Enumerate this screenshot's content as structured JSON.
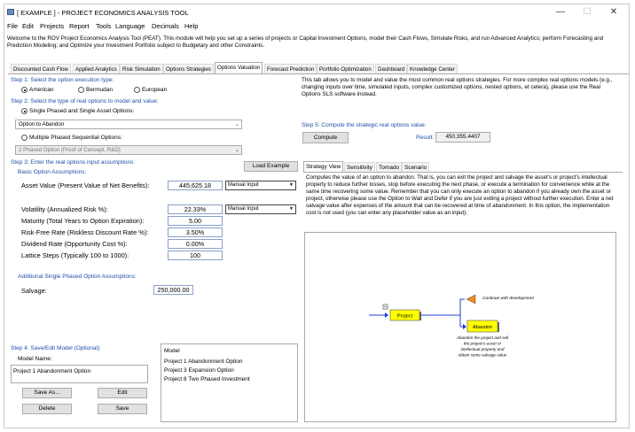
{
  "window": {
    "title": "[ EXAMPLE ] - PROJECT ECONOMICS ANALYSIS TOOL",
    "minimize": "—",
    "maximize": "☐",
    "close": "✕"
  },
  "menu": [
    "File",
    "Edit",
    "Projects",
    "Report",
    "Tools",
    "Language",
    "Decimals",
    "Help"
  ],
  "intro": "Welcome to the ROV Project Economics Analysis Tool (PEAT). This module will help you set up a series of projects or Capital Investment Options, model their Cash Flows, Simulate Risks, and run Advanced Analytics; perform Forecasting and Prediction Modeling; and Optimize your Investment Portfolio subject to Budgetary and other Constraints.",
  "tabs": [
    "Discounted Cash Flow",
    "Applied Analytics",
    "Risk Simulation",
    "Options Strategies",
    "Options Valuation",
    "Forecast Prediction",
    "Portfolio Optimization",
    "Dashboard",
    "Knowledge Center"
  ],
  "active_tab": "Options Valuation",
  "step1": {
    "title": "Step 1: Select the option execution type:",
    "options": [
      "American",
      "Bermudan",
      "European"
    ],
    "selected": "American"
  },
  "step2": {
    "title": "Step 2: Select the type of real options to model and value:",
    "single_label": "Single Phased and Single Asset Options:",
    "single_value": "Option to Abandon",
    "multi_label": "Multiple Phased Sequential Options:",
    "multi_value": "2 Phased Option (Proof of Concept, R&D)"
  },
  "step3": {
    "title": "Step 3: Enter the real options input assumptions:",
    "load_example": "Load Example",
    "basic_title": "Basic Option Assumptions:",
    "asset_value_label": "Asset Value (Present Value of Net Benefits):",
    "asset_value": "445,625.18",
    "asset_value_mode": "Manual Input",
    "volatility_label": "Volatility (Annualized Risk %):",
    "volatility": "22.33%",
    "volatility_mode": "Manual Input",
    "maturity_label": "Maturity (Total Years to Option Expiration):",
    "maturity": "5.00",
    "riskfree_label": "Risk-Free Rate (Riskless Discount Rate %):",
    "riskfree": "3.50%",
    "dividend_label": "Dividend Rate (Opportunity Cost %):",
    "dividend": "0.00%",
    "lattice_label": "Lattice Steps (Typically 100 to 1000):",
    "lattice": "100",
    "additional_title": "Additional Single Phased Option Assumptions:",
    "salvage_label": "Salvage:",
    "salvage": "250,000.00"
  },
  "step4": {
    "title": "Step 4: Save/Edit Model (Optional):",
    "model_name_label": "Model Name:",
    "model_name": "Project 1 Abandonment Option",
    "buttons": {
      "save_as": "Save As...",
      "edit": "Edit",
      "delete": "Delete",
      "save": "Save"
    },
    "list_header": "Model",
    "models": [
      "Project 1 Abandonment Option",
      "Project 3 Expansion Option",
      "Project 8 Two Phased Investment"
    ]
  },
  "right": {
    "info": "This tab allows you to model and value the most common real options strategies. For more complex real options models (e.g., changing inputs over time, simulated inputs, complex customized options, nested options, et cetera), please use the Real Options SLS software instead.",
    "step5_title": "Step 5: Compute the strategic real options value:",
    "compute": "Compute",
    "result_label": "Result:",
    "result": "450,355.4407",
    "subtabs": [
      "Strategy View",
      "Sensitivity",
      "Tornado",
      "Scenario"
    ],
    "description": "Computes the value of an option to abandon. That is, you can exit the project and salvage the asset's or project's intellectual property to reduce further losses, stop before executing the next phase, or execute a termination for convenience while at the same time recovering some value. Remember that you can only execute an option to abandon if you already own the asset or project, otherwise please use the Option to Wait and Defer if you are just exiting a project without further execution. Enter a net salvage value after expenses of the amount that can be recovered at time of abandonment. In this option, the implementation cost is not used (you can enter any placeholder value as an input).",
    "diagram": {
      "project": "Project",
      "abandon": "Abandon",
      "continue": "Continue with development",
      "abandon_note": [
        "Abandon the project and sell",
        "the project's asset or",
        "intellectual property and",
        "obtain some salvage value"
      ],
      "minus": "−"
    }
  },
  "colors": {
    "label_blue": "#1f4fa8",
    "node_fill": "#ffff00",
    "arrow_blue": "#1e3bd6",
    "triangle_orange": "#f08a1c"
  }
}
